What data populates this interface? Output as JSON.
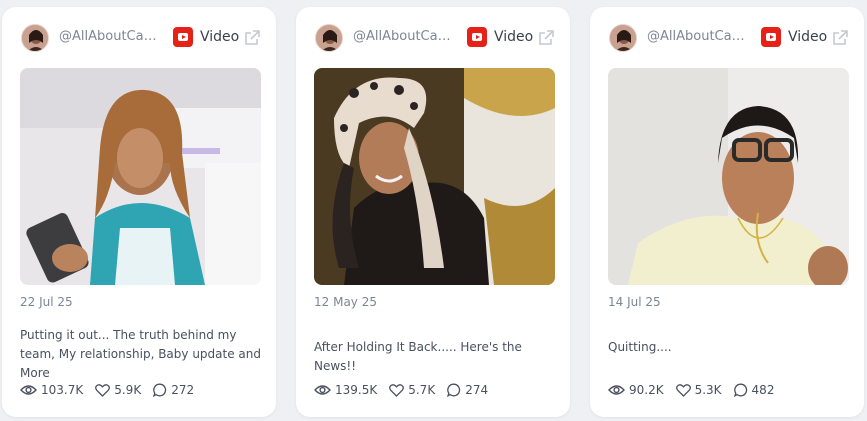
{
  "cards": [
    {
      "handle": "@AllAboutCar...",
      "platform": "Video",
      "date": "22 Jul 25",
      "title": "Putting it out... The truth behind my team, My relationship, Baby update and More",
      "views": "103.7K",
      "likes": "5.9K",
      "comments": "272"
    },
    {
      "handle": "@AllAboutCar...",
      "platform": "Video",
      "date": "12 May 25",
      "title": "After Holding It Back..... Here's the News!!",
      "views": "139.5K",
      "likes": "5.7K",
      "comments": "274"
    },
    {
      "handle": "@AllAboutCar...",
      "platform": "Video",
      "date": "14 Jul 25",
      "title": "Quitting....",
      "views": "90.2K",
      "likes": "5.3K",
      "comments": "482"
    }
  ],
  "icons": {
    "platform": "youtube-icon",
    "external": "external-link-icon",
    "views": "eye-icon",
    "likes": "heart-icon",
    "comments": "comment-icon"
  },
  "colors": {
    "youtube_red": "#e62117",
    "muted_text": "#7d8597",
    "body_text": "#4a5060"
  }
}
